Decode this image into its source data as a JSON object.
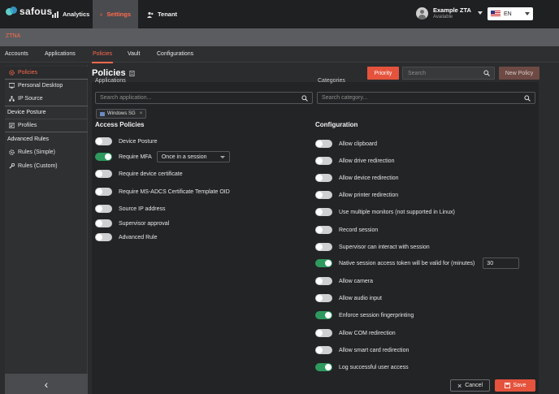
{
  "header": {
    "brand": "safous",
    "nav": [
      {
        "label": "Analytics",
        "icon": "bar-chart-icon"
      },
      {
        "label": "Settings",
        "icon": "gear-icon"
      },
      {
        "label": "Tenant",
        "icon": "tenant-icon"
      }
    ],
    "user": {
      "name": "Example ZTA",
      "status": "Available"
    },
    "language": "EN"
  },
  "section_label": "ZTNA",
  "subnav": [
    "Accounts",
    "Applications",
    "Policies",
    "Vault",
    "Configurations"
  ],
  "sidebar": {
    "items": [
      {
        "label": "Policies",
        "icon": "gear-icon"
      },
      {
        "label": "Personal Desktop",
        "icon": "desktop-icon"
      },
      {
        "label": "IP Source",
        "icon": "network-icon"
      }
    ],
    "device_posture": {
      "heading": "Device Posture",
      "items": [
        {
          "label": "Profiles",
          "icon": "profile-card-icon"
        }
      ]
    },
    "advanced_rules": {
      "heading": "Advanced Rules",
      "items": [
        {
          "label": "Rules (Simple)",
          "icon": "gear-icon"
        },
        {
          "label": "Rules (Custom)",
          "icon": "wrench-icon"
        }
      ]
    },
    "collapse_label": "‹"
  },
  "page": {
    "title": "Policies",
    "priority_label": "Priority",
    "search_placeholder": "Search",
    "new_policy_label": "New Policy"
  },
  "form": {
    "applications_label": "Applications",
    "categories_label": "Categories",
    "app_search_placeholder": "Search application...",
    "category_search_placeholder": "Search category...",
    "selected_app": "Windows SG",
    "access_policies_title": "Access Policies",
    "configuration_title": "Configuration",
    "access_policies": [
      {
        "label": "Device Posture",
        "on": false
      },
      {
        "label": "Require MFA",
        "on": true,
        "select_value": "Once in a session"
      },
      {
        "label": "Require device certificate",
        "on": false
      },
      {
        "label": "Require MS-ADCS Certificate Template OID",
        "on": false
      },
      {
        "label": "Source IP address",
        "on": false
      },
      {
        "label": "Supervisor approval",
        "on": false
      },
      {
        "label": "Advanced Rule",
        "on": false
      }
    ],
    "configuration": [
      {
        "label": "Allow clipboard",
        "on": false
      },
      {
        "label": "Allow drive redirection",
        "on": false
      },
      {
        "label": "Allow device redirection",
        "on": false
      },
      {
        "label": "Allow printer redirection",
        "on": false
      },
      {
        "label": "Use multiple monitors (not supported in Linux)",
        "on": false
      },
      {
        "label": "Record session",
        "on": false
      },
      {
        "label": "Supervisor can interact with session",
        "on": false
      },
      {
        "label": "Native session access token will be valid for (minutes)",
        "on": true,
        "value": "30"
      },
      {
        "label": "Allow camera",
        "on": false
      },
      {
        "label": "Allow audio input",
        "on": false
      },
      {
        "label": "Enforce session fingerprinting",
        "on": true
      },
      {
        "label": "Allow COM redirection",
        "on": false
      },
      {
        "label": "Allow smart card redirection",
        "on": false
      },
      {
        "label": "Log successful user access",
        "on": true
      }
    ],
    "cancel_label": "Cancel",
    "save_label": "Save"
  },
  "colors": {
    "accent": "#ff6a4d",
    "primary_button": "#e5533d",
    "toggle_on": "#2e9a5e",
    "toggle_off": "#cfd0d2"
  }
}
